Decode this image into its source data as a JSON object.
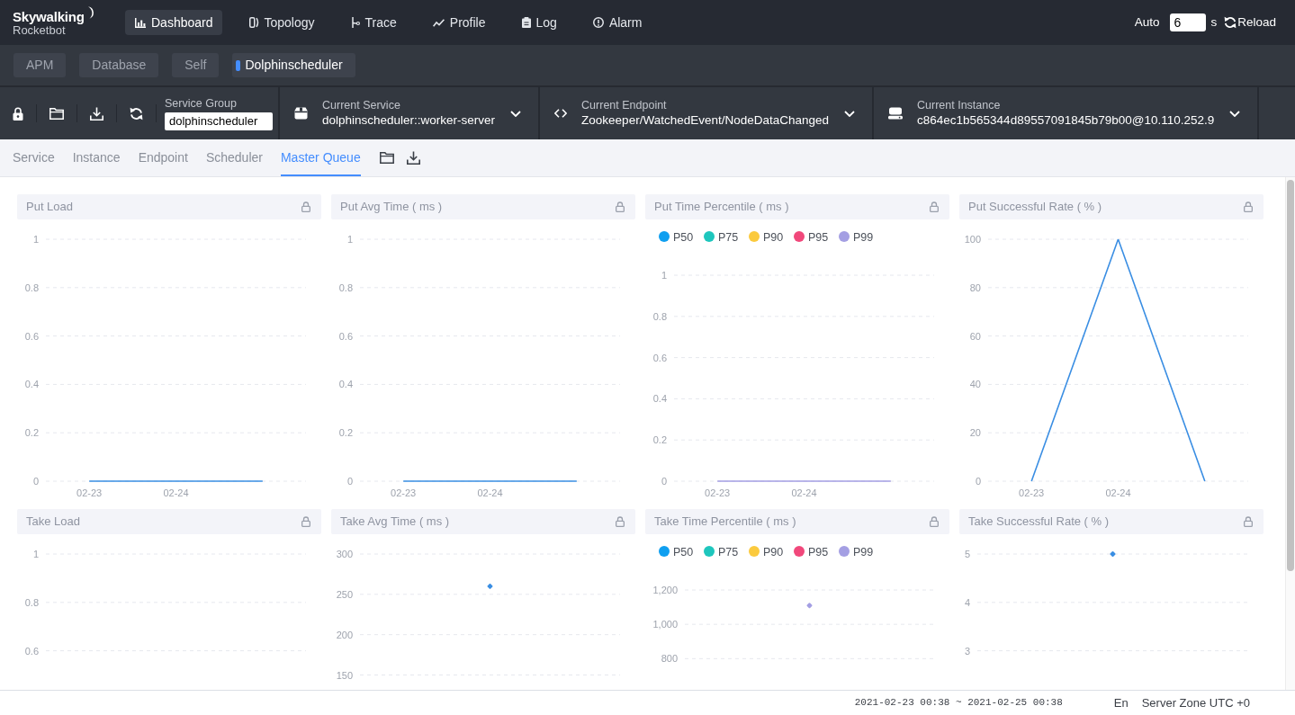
{
  "brand": {
    "name": "Skywalking",
    "subtitle": "Rocketbot"
  },
  "nav": [
    {
      "label": "Dashboard",
      "selected": true
    },
    {
      "label": "Topology",
      "selected": false
    },
    {
      "label": "Trace",
      "selected": false
    },
    {
      "label": "Profile",
      "selected": false
    },
    {
      "label": "Log",
      "selected": false
    },
    {
      "label": "Alarm",
      "selected": false
    }
  ],
  "auto_reload": {
    "label": "Auto",
    "interval": "6",
    "unit": "s",
    "button": "Reload"
  },
  "groups": [
    {
      "label": "APM",
      "selected": false
    },
    {
      "label": "Database",
      "selected": false
    },
    {
      "label": "Self",
      "selected": false
    },
    {
      "label": "Dolphinscheduler",
      "selected": true
    }
  ],
  "toolbar": {
    "service_group": {
      "label": "Service Group",
      "value": "dolphinscheduler"
    },
    "selectors": [
      {
        "label": "Current Service",
        "value": "dolphinscheduler::worker-server"
      },
      {
        "label": "Current Endpoint",
        "value": "Zookeeper/WatchedEvent/NodeDataChanged"
      },
      {
        "label": "Current Instance",
        "value": "c864ec1b565344d89557091845b79b00@10.110.252.9"
      }
    ]
  },
  "tabs": [
    {
      "label": "Service",
      "selected": false
    },
    {
      "label": "Instance",
      "selected": false
    },
    {
      "label": "Endpoint",
      "selected": false
    },
    {
      "label": "Scheduler",
      "selected": false
    },
    {
      "label": "Master Queue",
      "selected": true
    }
  ],
  "charts": [
    {
      "title": "Put Load",
      "chart_data": {
        "type": "line",
        "categories": [
          "02-23",
          "02-24",
          null
        ],
        "ylim": [
          0,
          1
        ],
        "yticks": [
          0,
          0.2,
          0.4,
          0.6,
          0.8,
          1
        ],
        "grid": true,
        "series": [
          {
            "color": "#3a8ee3",
            "values": [
              0,
              0,
              0
            ]
          }
        ]
      }
    },
    {
      "title": "Put Avg Time ( ms )",
      "chart_data": {
        "type": "line",
        "categories": [
          "02-23",
          "02-24",
          null
        ],
        "ylim": [
          0,
          1
        ],
        "yticks": [
          0,
          0.2,
          0.4,
          0.6,
          0.8,
          1
        ],
        "grid": true,
        "series": [
          {
            "color": "#3a8ee3",
            "values": [
              0,
              0,
              0
            ]
          }
        ]
      }
    },
    {
      "title": "Put Time Percentile ( ms )",
      "chart_data": {
        "type": "line",
        "categories": [
          "02-23",
          "02-24",
          null
        ],
        "ylim": [
          0,
          1
        ],
        "yticks": [
          0,
          0.2,
          0.4,
          0.6,
          0.8,
          1
        ],
        "grid": true,
        "series": [
          {
            "name": "P50",
            "color": "#0f9ff0",
            "values": [
              null,
              null,
              null
            ]
          },
          {
            "name": "P75",
            "color": "#1ec6bd",
            "values": [
              null,
              null,
              null
            ]
          },
          {
            "name": "P90",
            "color": "#fbca3e",
            "values": [
              null,
              null,
              null
            ]
          },
          {
            "name": "P95",
            "color": "#f1487b",
            "values": [
              null,
              null,
              null
            ]
          },
          {
            "name": "P99",
            "color": "#a49fe3",
            "values": [
              0,
              0,
              0
            ]
          }
        ]
      }
    },
    {
      "title": "Put Successful Rate ( % )",
      "chart_data": {
        "type": "line",
        "categories": [
          "02-23",
          "02-24",
          null
        ],
        "ylim": [
          0,
          100
        ],
        "yticks": [
          0,
          20,
          40,
          60,
          80,
          100
        ],
        "grid": true,
        "series": [
          {
            "color": "#3a8ee3",
            "values": [
              0,
              100,
              0
            ]
          }
        ]
      }
    },
    {
      "title": "Take Load",
      "chart_data": {
        "type": "line",
        "categories": [
          null,
          null,
          null
        ],
        "ylim": [
          0.6,
          1
        ],
        "yticks": [
          0.6,
          0.8,
          1
        ],
        "grid": true
      }
    },
    {
      "title": "Take Avg Time ( ms )",
      "chart_data": {
        "type": "line",
        "categories": [
          null,
          null,
          null
        ],
        "ylim": [
          150,
          300
        ],
        "yticks": [
          150,
          200,
          250,
          300
        ],
        "grid": true,
        "series": [
          {
            "color": "#3a8ee3",
            "marker": "diamond",
            "values": [
              null,
              260,
              null
            ]
          }
        ]
      }
    },
    {
      "title": "Take Time Percentile ( ms )",
      "chart_data": {
        "type": "line",
        "categories": [
          null,
          null,
          null
        ],
        "ylim": [
          800,
          1200
        ],
        "yticks": [
          800,
          {
            "value": 1000,
            "label": "1,000"
          },
          {
            "value": 1200,
            "label": "1,200"
          }
        ],
        "grid": true,
        "series": [
          {
            "name": "P50",
            "color": "#0f9ff0",
            "values": [
              null,
              null,
              null
            ]
          },
          {
            "name": "P75",
            "color": "#1ec6bd",
            "values": [
              null,
              null,
              null
            ]
          },
          {
            "name": "P90",
            "color": "#fbca3e",
            "values": [
              null,
              null,
              null
            ]
          },
          {
            "name": "P95",
            "color": "#f1487b",
            "values": [
              null,
              null,
              null
            ]
          },
          {
            "name": "P99",
            "color": "#a49fe3",
            "marker": "diamond",
            "values": [
              null,
              1110,
              null
            ]
          }
        ]
      }
    },
    {
      "title": "Take Successful Rate ( % )",
      "chart_data": {
        "type": "line",
        "categories": [
          null,
          null,
          null
        ],
        "ylim": [
          3,
          5
        ],
        "yticks": [
          3,
          4,
          5
        ],
        "grid": true,
        "series": [
          {
            "color": "#3a8ee3",
            "marker": "diamond",
            "values": [
              null,
              5,
              null
            ]
          }
        ]
      }
    }
  ],
  "status_bar": {
    "time_range": "2021-02-23 00:38 ~ 2021-02-25 00:38",
    "language": "En",
    "server_zone": "Server Zone UTC +0"
  }
}
